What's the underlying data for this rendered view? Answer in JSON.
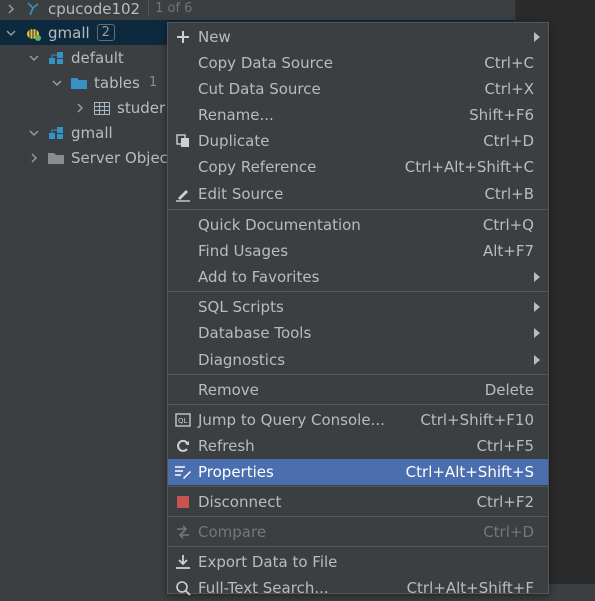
{
  "tree": {
    "rows": [
      {
        "name": "cpucode102",
        "hint": "1 of 6"
      },
      {
        "name": "gmall",
        "badge": "2"
      },
      {
        "name": "default"
      },
      {
        "name": "tables",
        "count": "1"
      },
      {
        "name": "studer"
      },
      {
        "name": "gmall"
      },
      {
        "name": "Server Objec"
      }
    ]
  },
  "menu": {
    "items": [
      {
        "label": "New",
        "shortcut": ""
      },
      {
        "label": "Copy Data Source",
        "shortcut": "Ctrl+C"
      },
      {
        "label": "Cut Data Source",
        "shortcut": "Ctrl+X"
      },
      {
        "label": "Rename...",
        "shortcut": "Shift+F6"
      },
      {
        "label": "Duplicate",
        "shortcut": "Ctrl+D"
      },
      {
        "label": "Copy Reference",
        "shortcut": "Ctrl+Alt+Shift+C"
      },
      {
        "label": "Edit Source",
        "shortcut": "Ctrl+B"
      },
      {
        "label": "Quick Documentation",
        "shortcut": "Ctrl+Q"
      },
      {
        "label": "Find Usages",
        "shortcut": "Alt+F7"
      },
      {
        "label": "Add to Favorites",
        "shortcut": ""
      },
      {
        "label": "SQL Scripts",
        "shortcut": ""
      },
      {
        "label": "Database Tools",
        "shortcut": ""
      },
      {
        "label": "Diagnostics",
        "shortcut": ""
      },
      {
        "label": "Remove",
        "shortcut": "Delete"
      },
      {
        "label": "Jump to Query Console...",
        "shortcut": "Ctrl+Shift+F10"
      },
      {
        "label": "Refresh",
        "shortcut": "Ctrl+F5"
      },
      {
        "label": "Properties",
        "shortcut": "Ctrl+Alt+Shift+S"
      },
      {
        "label": "Disconnect",
        "shortcut": "Ctrl+F2"
      },
      {
        "label": "Compare",
        "shortcut": "Ctrl+D"
      },
      {
        "label": "Export Data to File",
        "shortcut": ""
      },
      {
        "label": "Full-Text Search...",
        "shortcut": "Ctrl+Alt+Shift+F"
      }
    ]
  },
  "colors": {
    "background": "#3c3f41",
    "highlight": "#4b6eaf",
    "disconnect_red": "#c75450",
    "folder_blue": "#3592c4"
  }
}
